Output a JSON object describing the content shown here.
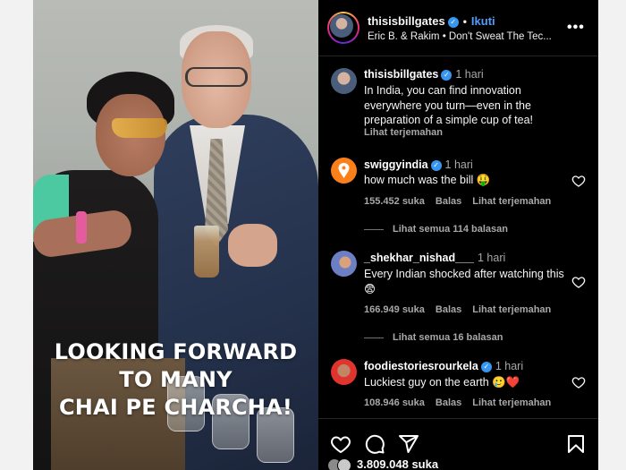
{
  "post": {
    "username": "thisisbillgates",
    "follow_label": "Ikuti",
    "audio": "Eric B. & Rakim • Don't Sweat The Tec...",
    "caption_lines": [
      "LOOKING FORWARD",
      "TO MANY",
      "CHAI PE CHARCHA!"
    ]
  },
  "main_comment": {
    "username": "thisisbillgates",
    "time": "1 hari",
    "text": "In India, you can find innovation everywhere you turn—even in the preparation of a simple cup of tea!",
    "translate": "Lihat terjemahan"
  },
  "comments": [
    {
      "username": "swiggyindia",
      "time": "1 hari",
      "text": "how much was the bill 🤑",
      "likes": "155.452 suka",
      "reply": "Balas",
      "translate": "Lihat terjemahan",
      "view_replies": "Lihat semua 114 balasan",
      "avatar_color": "#fc8019"
    },
    {
      "username": "_shekhar_nishad___",
      "time": "1 hari",
      "text": "Every Indian shocked after watching this 😨",
      "likes": "166.949 suka",
      "reply": "Balas",
      "translate": "Lihat terjemahan",
      "view_replies": "Lihat semua 16 balasan",
      "avatar_color": "#7b8fd6"
    },
    {
      "username": "foodiestoriesrourkela",
      "time": "1 hari",
      "text": "Luckiest guy on the earth 🥲❤️",
      "likes": "108.946 suka",
      "reply": "Balas",
      "translate": "Lihat terjemahan",
      "avatar_color": "#e0342f"
    }
  ],
  "footer": {
    "likes": "3.809.048 suka"
  },
  "icons": {
    "verified": "verified-badge-icon",
    "more": "more-options-icon",
    "heart": "heart-icon",
    "comment": "comment-icon",
    "share": "share-icon",
    "save": "bookmark-icon"
  },
  "colors": {
    "link_blue": "#4f9cf9",
    "verified_blue": "#3797f0",
    "panel_bg": "#000000",
    "secondary_text": "#a8a8a8"
  }
}
